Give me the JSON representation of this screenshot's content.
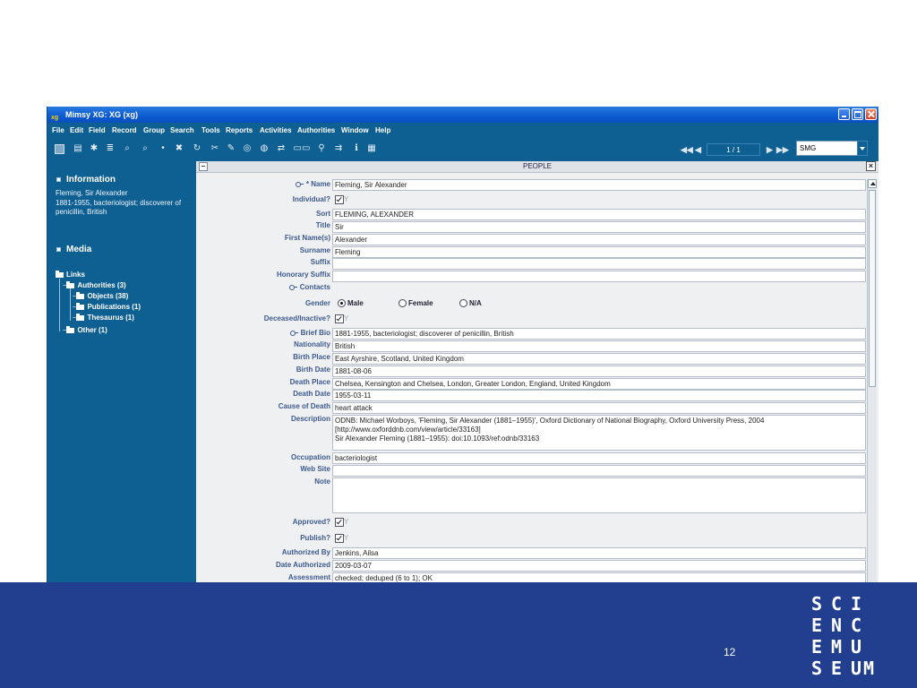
{
  "window": {
    "title": "Mimsy XG:  XG (xg)",
    "app_icon": "xg"
  },
  "menu": [
    "File",
    "Edit",
    "Field",
    "Record",
    "Group",
    "Search",
    "Tools",
    "Reports",
    "Activities",
    "Authorities",
    "Window",
    "Help"
  ],
  "toolbar": {
    "icons": [
      "new-record-icon",
      "print-icon",
      "spell-check-icon",
      "list-icon",
      "find-icon",
      "find-next-icon",
      "magnify-icon",
      "tools-icon",
      "refresh-icon",
      "attach-icon",
      "edit-icon",
      "target-icon",
      "globe-icon",
      "link-icon",
      "ellipsis-icon",
      "hierarchy-icon",
      "transfer-icon",
      "info-icon",
      "grid-icon"
    ],
    "record_counter": "1 / 1",
    "database": "SMG"
  },
  "left_panel": {
    "information_heading": "Information",
    "information_text": [
      "Fleming, Sir Alexander",
      "1881-1955, bacteriologist; discoverer of",
      "penicillin, British"
    ],
    "media_heading": "Media",
    "links": {
      "root": "Links",
      "authorities": "Authorities (3)",
      "children": [
        "Objects (38)",
        "Publications (1)",
        "Thesaurus (1)"
      ],
      "other": "Other (1)"
    }
  },
  "form": {
    "title": "PEOPLE",
    "fields": {
      "name": {
        "label": "* Name",
        "value": "Fleming, Sir Alexander"
      },
      "individual": {
        "label": "Individual?",
        "check": "Y"
      },
      "sort": {
        "label": "Sort",
        "value": "FLEMING, ALEXANDER"
      },
      "title": {
        "label": "Title",
        "value": "Sir"
      },
      "first_names": {
        "label": "First Name(s)",
        "value": "Alexander"
      },
      "surname": {
        "label": "Surname",
        "value": "Fleming"
      },
      "suffix": {
        "label": "Suffix",
        "value": ""
      },
      "honorary_suffix": {
        "label": "Honorary Suffix",
        "value": ""
      },
      "contacts": {
        "label": "Contacts"
      },
      "gender": {
        "label": "Gender",
        "options": [
          "Male",
          "Female",
          "N/A"
        ],
        "selected": "Male"
      },
      "deceased": {
        "label": "Deceased/Inactive?",
        "check": "Y"
      },
      "brief_bio": {
        "label": "Brief Bio",
        "value": "1881-1955, bacteriologist; discoverer of penicillin, British"
      },
      "nationality": {
        "label": "Nationality",
        "value": "British"
      },
      "birth_place": {
        "label": "Birth Place",
        "value": "East Ayrshire, Scotland, United Kingdom"
      },
      "birth_date": {
        "label": "Birth Date",
        "value": "1881-08-06"
      },
      "death_place": {
        "label": "Death Place",
        "value": "Chelsea, Kensington and Chelsea, London, Greater London, England, United Kingdom"
      },
      "death_date": {
        "label": "Death Date",
        "value": "1955-03-11"
      },
      "cause_of_death": {
        "label": "Cause of Death",
        "value": "heart attack"
      },
      "description": {
        "label": "Description",
        "value_line1": "ODNB: Michael Worboys, 'Fleming, Sir Alexander (1881–1955)', Oxford Dictionary of National Biography, Oxford University Press, 2004 [http://www.oxforddnb.com/view/article/33163]",
        "value_line2": "Sir Alexander Fleming (1881–1955): doi:10.1093/ref:odnb/33163"
      },
      "occupation": {
        "label": "Occupation",
        "value": "bacteriologist"
      },
      "web_site": {
        "label": "Web Site",
        "value": ""
      },
      "note": {
        "label": "Note",
        "value": ""
      },
      "approved": {
        "label": "Approved?",
        "check": "Y"
      },
      "publish": {
        "label": "Publish?",
        "check": "Y"
      },
      "authorized_by": {
        "label": "Authorized By",
        "value": "Jenkins, Ailsa"
      },
      "date_authorized": {
        "label": "Date Authorized",
        "value": "2009-03-07"
      },
      "assessment": {
        "label": "Assessment",
        "value": "checked; deduped (6 to 1); OK"
      }
    }
  },
  "slide": {
    "page_number": "12",
    "logo_letters": [
      "S",
      "C",
      "I",
      "E",
      "N",
      "C",
      "E",
      "M",
      "U",
      "S",
      "E",
      "U",
      "M"
    ],
    "footer_color": "#223f8f",
    "brand_color": "#0e5f92"
  }
}
